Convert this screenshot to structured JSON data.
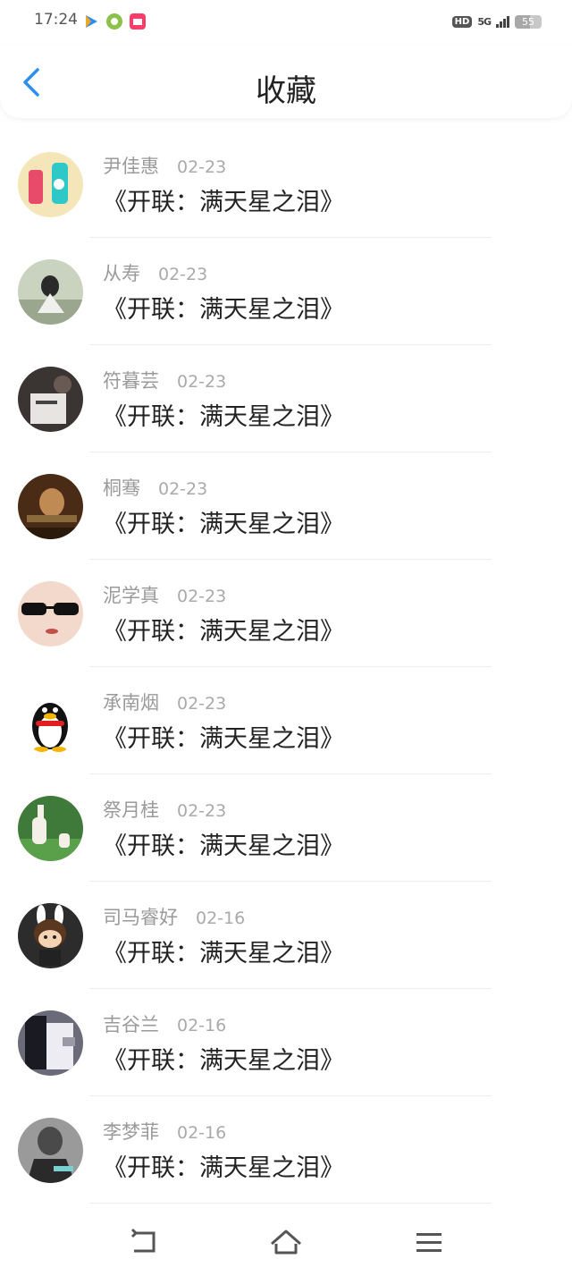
{
  "status": {
    "time": "17:24",
    "hd": "HD",
    "network": "5G",
    "battery": "55"
  },
  "header": {
    "title": "收藏"
  },
  "items": [
    {
      "name": "尹佳惠",
      "date": "02-23",
      "song": "《开联：满天星之泪》"
    },
    {
      "name": "从寿",
      "date": "02-23",
      "song": "《开联：满天星之泪》"
    },
    {
      "name": "符暮芸",
      "date": "02-23",
      "song": "《开联：满天星之泪》"
    },
    {
      "name": "桐骞",
      "date": "02-23",
      "song": "《开联：满天星之泪》"
    },
    {
      "name": "泥学真",
      "date": "02-23",
      "song": "《开联：满天星之泪》"
    },
    {
      "name": "承南烟",
      "date": "02-23",
      "song": "《开联：满天星之泪》"
    },
    {
      "name": "祭月桂",
      "date": "02-23",
      "song": "《开联：满天星之泪》"
    },
    {
      "name": "司马睿好",
      "date": "02-16",
      "song": "《开联：满天星之泪》"
    },
    {
      "name": "吉谷兰",
      "date": "02-16",
      "song": "《开联：满天星之泪》"
    },
    {
      "name": "李梦菲",
      "date": "02-16",
      "song": "《开联：满天星之泪》"
    }
  ],
  "colors": {
    "accent": "#2b8ef0",
    "text": "#222222",
    "meta": "#9a9a9a"
  }
}
